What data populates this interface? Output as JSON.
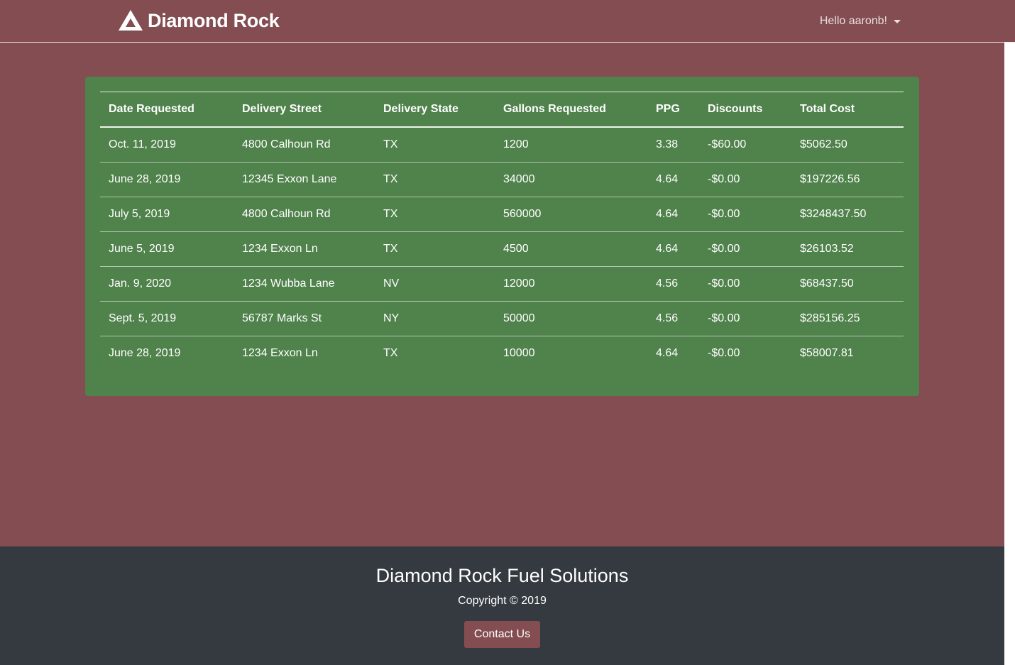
{
  "navbar": {
    "brand": "Diamond Rock",
    "greeting": "Hello aaronb!"
  },
  "table": {
    "headers": [
      "Date Requested",
      "Delivery Street",
      "Delivery State",
      "Gallons Requested",
      "PPG",
      "Discounts",
      "Total Cost"
    ],
    "rows": [
      [
        "Oct. 11, 2019",
        "4800 Calhoun Rd",
        "TX",
        "1200",
        "3.38",
        "-$60.00",
        "$5062.50"
      ],
      [
        "June 28, 2019",
        "12345 Exxon Lane",
        "TX",
        "34000",
        "4.64",
        "-$0.00",
        "$197226.56"
      ],
      [
        "July 5, 2019",
        "4800 Calhoun Rd",
        "TX",
        "560000",
        "4.64",
        "-$0.00",
        "$3248437.50"
      ],
      [
        "June 5, 2019",
        "1234 Exxon Ln",
        "TX",
        "4500",
        "4.64",
        "-$0.00",
        "$26103.52"
      ],
      [
        "Jan. 9, 2020",
        "1234 Wubba Lane",
        "NV",
        "12000",
        "4.56",
        "-$0.00",
        "$68437.50"
      ],
      [
        "Sept. 5, 2019",
        "56787 Marks St",
        "NY",
        "50000",
        "4.56",
        "-$0.00",
        "$285156.25"
      ],
      [
        "June 28, 2019",
        "1234 Exxon Ln",
        "TX",
        "10000",
        "4.64",
        "-$0.00",
        "$58007.81"
      ]
    ]
  },
  "footer": {
    "title": "Diamond Rock Fuel Solutions",
    "copyright": "Copyright © 2019",
    "contact_label": "Contact Us"
  },
  "colors": {
    "page_background": "#834d51",
    "card_background": "#50824c",
    "footer_background": "#343a40",
    "button_background": "#834d51"
  },
  "icons": {
    "brand_logo": "mountain-icon",
    "user_menu": "caret-down-icon"
  }
}
